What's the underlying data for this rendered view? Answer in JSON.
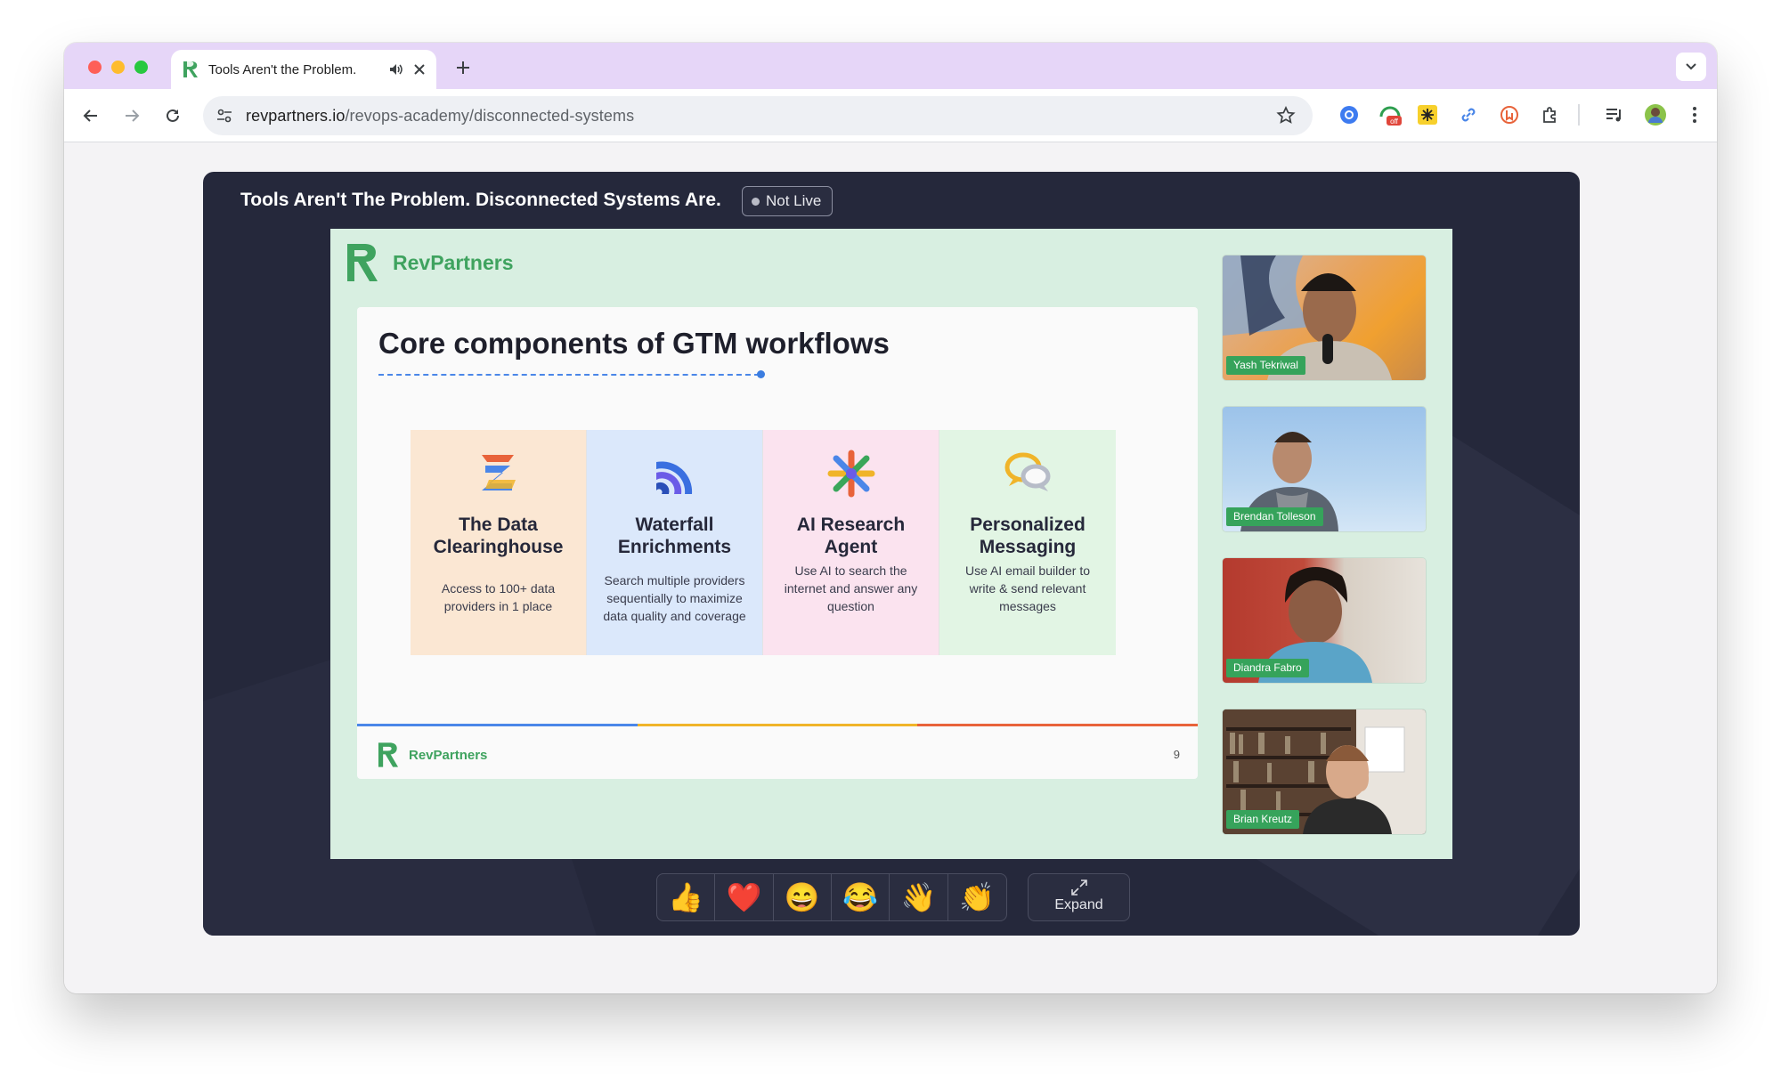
{
  "browser": {
    "tab": {
      "title": "Tools Aren't the Problem.",
      "favicon": "revpartners-logo"
    },
    "address": {
      "domain": "revpartners.io",
      "path": "/revops-academy/disconnected-systems"
    },
    "icons": [
      "back-icon",
      "forward-icon",
      "reload-icon",
      "site-settings-icon",
      "bookmark-star-icon",
      "extensions-icon",
      "media-controls-icon",
      "profile-avatar",
      "menu-icon"
    ]
  },
  "event": {
    "title": "Tools Aren't The Problem. Disconnected Systems Are.",
    "status": "Not Live"
  },
  "slide": {
    "brand": "RevPartners",
    "title": "Core components of GTM workflows",
    "components": [
      {
        "title": "The Data Clearinghouse",
        "description": "Access to 100+ data providers in 1 place",
        "bg": "#fbe7d3"
      },
      {
        "title": "Waterfall Enrichments",
        "description": "Search multiple providers sequentially to maximize data quality and coverage",
        "bg": "#dbe8fb"
      },
      {
        "title": "AI Research Agent",
        "description": "Use AI to search the internet and answer any question",
        "bg": "#fbe3ef"
      },
      {
        "title": "Personalized Messaging",
        "description": "Use AI email builder to write & send relevant messages",
        "bg": "#e2f5e4"
      }
    ],
    "footer_brand": "RevPartners",
    "page_number": "9",
    "colorbar": [
      "#4a86e8",
      "#f0b429",
      "#e8633a"
    ]
  },
  "participants": [
    {
      "name": "Yash Tekriwal"
    },
    {
      "name": "Brendan Tolleson"
    },
    {
      "name": "Diandra Fabro"
    },
    {
      "name": "Brian Kreutz"
    }
  ],
  "reactions": [
    "👍",
    "❤️",
    "😄",
    "😂",
    "👋",
    "👏"
  ],
  "expand_label": "Expand"
}
